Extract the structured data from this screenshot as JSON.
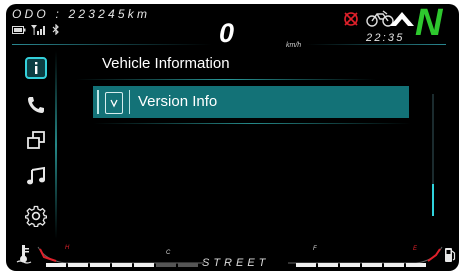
{
  "odometer": {
    "text": "ODO : 223245km"
  },
  "speed": {
    "value": "0",
    "unit": "km/h"
  },
  "clock": {
    "time": "22:35"
  },
  "gear": {
    "indicator": "N"
  },
  "colors": {
    "accent": "#137277",
    "gear": "#2ec82e",
    "warning": "#e0202a",
    "thumb": "#30d3dc"
  },
  "sidebar": {
    "items": [
      {
        "icon": "info-icon",
        "selected": true
      },
      {
        "icon": "phone-icon",
        "selected": false
      },
      {
        "icon": "windows-icon",
        "selected": false
      },
      {
        "icon": "music-icon",
        "selected": false
      },
      {
        "icon": "gear-icon",
        "selected": false
      }
    ]
  },
  "main": {
    "title": "Vehicle Information",
    "items": [
      {
        "label": "Version Info",
        "icon": "version-icon",
        "selected": true
      }
    ]
  },
  "gauges": {
    "mode": "STREET",
    "temp_low": "C",
    "temp_high": "H",
    "fuel_full": "F",
    "fuel_empty": "E"
  }
}
